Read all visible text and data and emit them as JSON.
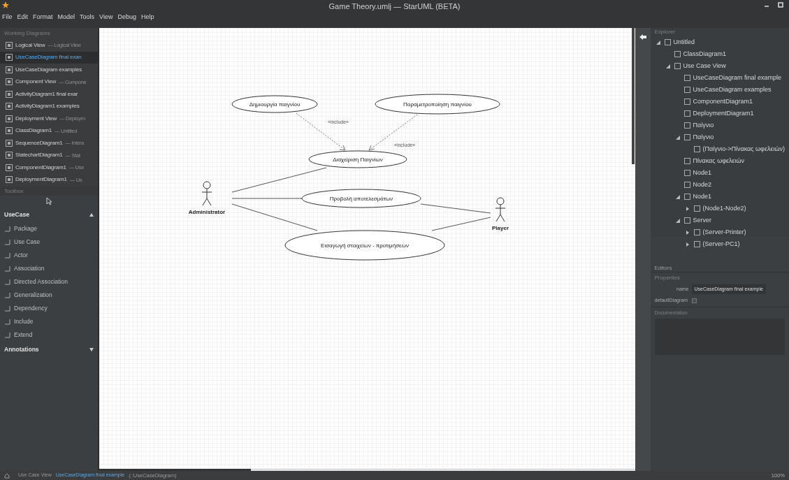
{
  "window": {
    "title": "Game Theory.umlj — StarUML (BETA)"
  },
  "menu": [
    "File",
    "Edit",
    "Format",
    "Model",
    "Tools",
    "View",
    "Debug",
    "Help"
  ],
  "working_diagrams": {
    "title": "Working Diagrams",
    "items": [
      {
        "name": "Logical View",
        "suffix": "— Logical View",
        "selected": false
      },
      {
        "name": "UseCaseDiagram final exan",
        "selected": true
      },
      {
        "name": "UseCaseDiagram examples",
        "selected": false
      },
      {
        "name": "Component View",
        "suffix": "— Compone",
        "selected": false
      },
      {
        "name": "ActivityDiagram1 final exar",
        "selected": false
      },
      {
        "name": "ActivityDiagram1 examples",
        "selected": false
      },
      {
        "name": "Deployment View",
        "suffix": "— Deploym",
        "selected": false
      },
      {
        "name": "ClassDiagram1",
        "suffix": "— Untitled",
        "selected": false
      },
      {
        "name": "SequenceDiagram1",
        "suffix": "— Intera",
        "selected": false
      },
      {
        "name": "StatechartDiagram1",
        "suffix": "— Stat",
        "selected": false
      },
      {
        "name": "ComponentDiagram1",
        "suffix": "— Use",
        "selected": false
      },
      {
        "name": "DeploymentDiagram1",
        "suffix": "— Us",
        "selected": false
      }
    ]
  },
  "toolbox": {
    "title": "Toolbox",
    "groups": [
      {
        "label": "UseCase",
        "expanded": true,
        "items": [
          "Package",
          "Use Case",
          "Actor",
          "Association",
          "Directed Association",
          "Generalization",
          "Dependency",
          "Include",
          "Extend"
        ]
      },
      {
        "label": "Annotations",
        "expanded": false
      }
    ]
  },
  "diagram": {
    "use_cases": [
      {
        "label": "Δημιουργία παιγνίου"
      },
      {
        "label": "Παραμετροποίηση παιγνίου"
      },
      {
        "label": "Διαχείριση Παιγνίων"
      },
      {
        "label": "Προβολή αποτελεσμάτων"
      },
      {
        "label": "Εισαγωγή στοιχείων - προτιμήσεων"
      }
    ],
    "actors": [
      {
        "name": "Administrator"
      },
      {
        "name": "Player"
      }
    ],
    "include_labels": [
      "«include»",
      "«include»"
    ]
  },
  "explorer": {
    "title": "Explorer",
    "tree": [
      {
        "label": "Untitled",
        "expanded": true,
        "children": [
          {
            "label": "ClassDiagram1"
          },
          {
            "label": "Use Case View",
            "expanded": true,
            "children": [
              {
                "label": "UseCaseDiagram final example"
              },
              {
                "label": "UseCaseDiagram examples"
              },
              {
                "label": "ComponentDiagram1"
              },
              {
                "label": "DeploymentDiagram1"
              },
              {
                "label": "Παίγνιο"
              },
              {
                "label": "Παίγνιο",
                "expanded": true,
                "children": [
                  {
                    "label": "(Παίγνιο->Πίνακας ωφελειών)"
                  }
                ]
              },
              {
                "label": "Πίνακας ωφελειών"
              },
              {
                "label": "Node1"
              },
              {
                "label": "Node2"
              },
              {
                "label": "Node1",
                "expanded": true,
                "children": [
                  {
                    "label": "(Node1-Node2)",
                    "expanded": false
                  }
                ]
              },
              {
                "label": "Server",
                "expanded": true,
                "children": [
                  {
                    "label": "(Server-Printer)",
                    "expanded": false
                  },
                  {
                    "label": "(Server-PC1)",
                    "expanded": false
                  }
                ]
              }
            ]
          }
        ]
      }
    ]
  },
  "editors": {
    "title": "Editors"
  },
  "properties": {
    "title": "Properties",
    "name_label": "name",
    "name_value": "UseCaseDiagram final example",
    "default_label": "defaultDiagram",
    "default_checked": false
  },
  "documentation": {
    "title": "Documentation"
  },
  "status_bar": {
    "items": [
      "Use Case View",
      "UseCaseDiagram final example",
      "(::UseCaseDiagram)"
    ],
    "zoom": "100%"
  }
}
